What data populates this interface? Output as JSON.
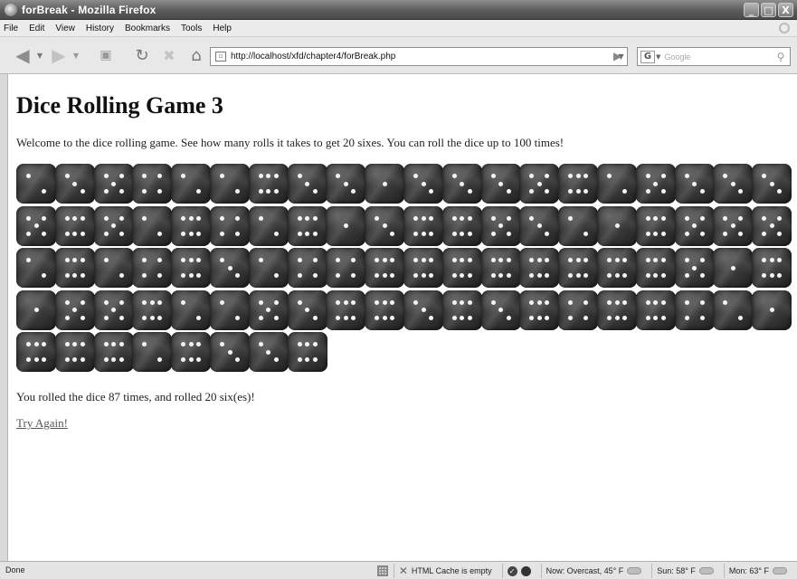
{
  "window": {
    "title": "forBreak - Mozilla Firefox",
    "buttons": {
      "minimize": "_",
      "maximize": "□",
      "close": "X"
    }
  },
  "menu": {
    "items": [
      "File",
      "Edit",
      "View",
      "History",
      "Bookmarks",
      "Tools",
      "Help"
    ]
  },
  "toolbar": {
    "url": "http://localhost/xfd/chapter4/forBreak.php",
    "search_placeholder": "Google",
    "engine_glyph": "G"
  },
  "page": {
    "title": "Dice Rolling Game 3",
    "intro": "Welcome to the dice rolling game. See how many rolls it takes to get 20 sixes. You can roll the dice up to 100 times!",
    "dice": [
      2,
      3,
      5,
      4,
      2,
      2,
      6,
      3,
      3,
      1,
      3,
      3,
      3,
      5,
      6,
      2,
      5,
      3,
      3,
      3,
      5,
      6,
      5,
      2,
      6,
      4,
      2,
      6,
      1,
      3,
      6,
      6,
      5,
      3,
      2,
      1,
      6,
      5,
      5,
      5,
      2,
      6,
      2,
      4,
      6,
      3,
      2,
      4,
      4,
      6,
      6,
      6,
      6,
      6,
      6,
      6,
      6,
      5,
      1,
      6,
      1,
      5,
      5,
      6,
      2,
      2,
      5,
      3,
      6,
      6,
      3,
      6,
      3,
      6,
      4,
      6,
      6,
      4,
      2,
      1,
      6,
      6,
      6,
      2,
      6,
      3,
      3,
      6
    ],
    "result": "You rolled the dice 87 times, and rolled 20 six(es)!",
    "try_again": "Try Again!"
  },
  "status": {
    "left": "Done",
    "cache": "HTML Cache is empty",
    "weather_now": "Now: Overcast, 45° F",
    "weather_sun": "Sun: 58° F",
    "weather_mon": "Mon: 63° F"
  }
}
